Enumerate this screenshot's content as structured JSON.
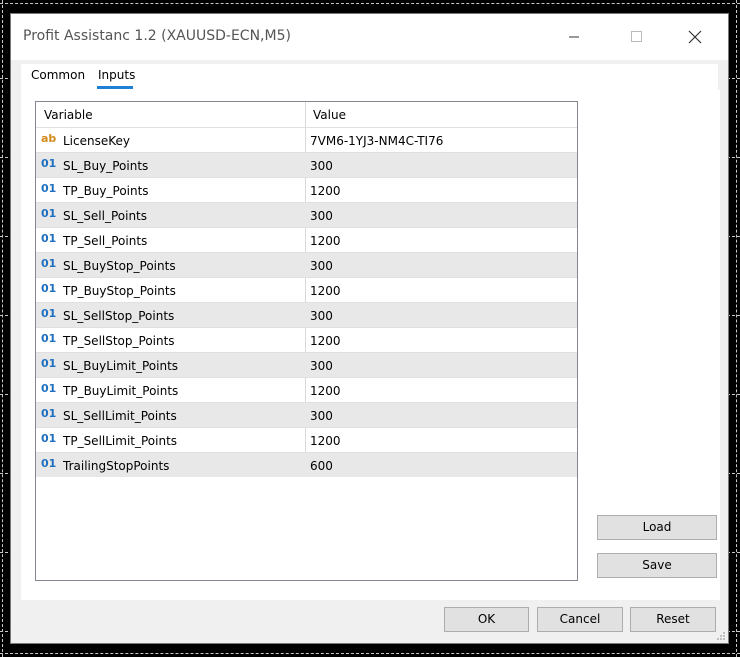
{
  "window": {
    "title": "Profit Assistanc 1.2 (XAUUSD-ECN,M5)"
  },
  "tabs": [
    {
      "label": "Common",
      "active": false
    },
    {
      "label": "Inputs",
      "active": true
    }
  ],
  "grid": {
    "columns": [
      "Variable",
      "Value"
    ],
    "rows": [
      {
        "type_icon": "ab",
        "name": "LicenseKey",
        "value": "7VM6-1YJ3-NM4C-TI76"
      },
      {
        "type_icon": "01",
        "name": "SL_Buy_Points",
        "value": "300"
      },
      {
        "type_icon": "01",
        "name": "TP_Buy_Points",
        "value": "1200"
      },
      {
        "type_icon": "01",
        "name": "SL_Sell_Points",
        "value": "300"
      },
      {
        "type_icon": "01",
        "name": "TP_Sell_Points",
        "value": "1200"
      },
      {
        "type_icon": "01",
        "name": "SL_BuyStop_Points",
        "value": "300"
      },
      {
        "type_icon": "01",
        "name": "TP_BuyStop_Points",
        "value": "1200"
      },
      {
        "type_icon": "01",
        "name": "SL_SellStop_Points",
        "value": "300"
      },
      {
        "type_icon": "01",
        "name": "TP_SellStop_Points",
        "value": "1200"
      },
      {
        "type_icon": "01",
        "name": "SL_BuyLimit_Points",
        "value": "300"
      },
      {
        "type_icon": "01",
        "name": "TP_BuyLimit_Points",
        "value": "1200"
      },
      {
        "type_icon": "01",
        "name": "SL_SellLimit_Points",
        "value": "300"
      },
      {
        "type_icon": "01",
        "name": "TP_SellLimit_Points",
        "value": "1200"
      },
      {
        "type_icon": "01",
        "name": "TrailingStopPoints",
        "value": "600"
      }
    ]
  },
  "side_buttons": {
    "load": "Load",
    "save": "Save"
  },
  "footer_buttons": {
    "ok": "OK",
    "cancel": "Cancel",
    "reset": "Reset"
  },
  "colors": {
    "accent": "#1e7fd4",
    "int_icon": "#1e6fc0",
    "string_icon": "#d28a1a"
  }
}
